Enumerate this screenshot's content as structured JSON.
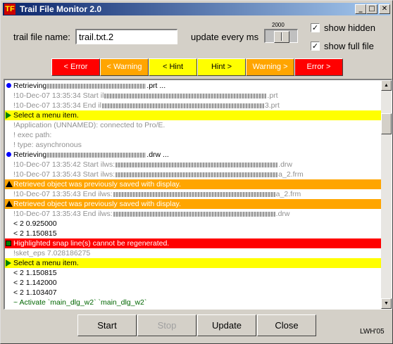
{
  "window": {
    "title": "Trail File Monitor 2.0",
    "controls": {
      "minimize": "_",
      "maximize": "□",
      "close": "✕"
    }
  },
  "settings": {
    "trail_label": "trail file name:",
    "trail_value": "trail.txt.2",
    "update_label": "update every ms",
    "update_value": "2000",
    "update_slider_fraction": 0.5,
    "show_hidden_label": "show hidden",
    "show_hidden_checked": true,
    "show_full_file_label": "show full file",
    "show_full_file_checked": true
  },
  "filters": [
    {
      "label": "< Error",
      "color": "#ff0000",
      "text_color": "#ffffff"
    },
    {
      "label": "< Warning",
      "color": "#ffa500",
      "text_color": "#ffffff"
    },
    {
      "label": "< Hint",
      "color": "#ffff00",
      "text_color": "#000000"
    },
    {
      "label": "Hint >",
      "color": "#ffff00",
      "text_color": "#000000"
    },
    {
      "label": "Warning >",
      "color": "#ffa500",
      "text_color": "#ffffff"
    },
    {
      "label": "Error >",
      "color": "#ff0000",
      "text_color": "#ffffff"
    }
  ],
  "log": [
    {
      "kind": "normal",
      "marker": "dot-icon",
      "text": "Retrieving",
      "redacted": "long",
      "text_after": ".prt ..."
    },
    {
      "kind": "grey",
      "marker": "",
      "text": "!10-Dec-07 13:35:34  Start  il",
      "redacted": "xl",
      "text_after": ".prt"
    },
    {
      "kind": "grey",
      "marker": "",
      "text": "!10-Dec-07 13:35:34  End    il",
      "redacted": "xl",
      "text_after": "3.prt"
    },
    {
      "kind": "hint",
      "marker": "arrow-right-icon",
      "text": "Select a menu item.",
      "redacted": "",
      "text_after": ""
    },
    {
      "kind": "grey",
      "marker": "",
      "text": "!Application (UNNAMED): connected to Pro/E.",
      "redacted": "",
      "text_after": ""
    },
    {
      "kind": "grey",
      "marker": "",
      "text": "!   exec path:",
      "redacted": "",
      "text_after": ""
    },
    {
      "kind": "grey",
      "marker": "",
      "text": "!   type: asynchronous",
      "redacted": "",
      "text_after": ""
    },
    {
      "kind": "normal",
      "marker": "dot-icon",
      "text": "Retrieving",
      "redacted": "long",
      "text_after": ".drw ..."
    },
    {
      "kind": "grey",
      "marker": "",
      "text": "!10-Dec-07 13:35:42  Start  ilws:",
      "redacted": "xl",
      "text_after": ".drw"
    },
    {
      "kind": "grey",
      "marker": "",
      "text": "!10-Dec-07 13:35:43  Start  ilws:",
      "redacted": "xl",
      "text_after": "a_2.frm"
    },
    {
      "kind": "warning",
      "marker": "warning-triangle-icon",
      "text": "Retrieved object was previously saved with display.",
      "redacted": "",
      "text_after": ""
    },
    {
      "kind": "grey",
      "marker": "",
      "text": "!10-Dec-07 13:35:43  End   ilws:",
      "redacted": "xl",
      "text_after": "a_2.frm"
    },
    {
      "kind": "warning",
      "marker": "warning-triangle-icon",
      "text": "Retrieved object was previously saved with display.",
      "redacted": "",
      "text_after": ""
    },
    {
      "kind": "grey",
      "marker": "",
      "text": "!10-Dec-07 13:35:43  End   ilws:",
      "redacted": "xl",
      "text_after": ".drw"
    },
    {
      "kind": "normal",
      "marker": "",
      "text": "< 2 0.925000",
      "redacted": "",
      "text_after": ""
    },
    {
      "kind": "normal",
      "marker": "",
      "text": "< 2 1.150815",
      "redacted": "",
      "text_after": ""
    },
    {
      "kind": "error",
      "marker": "error-icon",
      "text": "Highlighted snap line(s) cannot be regenerated.",
      "redacted": "",
      "text_after": ""
    },
    {
      "kind": "grey",
      "marker": "",
      "text": "!sket_eps        7.028186275",
      "redacted": "",
      "text_after": ""
    },
    {
      "kind": "hint",
      "marker": "arrow-right-icon",
      "text": "Select a menu item.",
      "redacted": "",
      "text_after": ""
    },
    {
      "kind": "normal",
      "marker": "",
      "text": "< 2 1.150815",
      "redacted": "",
      "text_after": ""
    },
    {
      "kind": "normal",
      "marker": "",
      "text": "< 2 1.142000",
      "redacted": "",
      "text_after": ""
    },
    {
      "kind": "normal",
      "marker": "",
      "text": "< 2 1.103407",
      "redacted": "",
      "text_after": ""
    },
    {
      "kind": "green",
      "marker": "",
      "text": "~ Activate `main_dlg_w2` `main_dlg_w2`",
      "redacted": "",
      "text_after": ""
    }
  ],
  "scrollbar": {
    "up": "▲",
    "down": "▼",
    "position_fraction": 0.12
  },
  "actions": {
    "start": "Start",
    "stop": "Stop",
    "update": "Update",
    "close": "Close"
  },
  "signature": "LWH'05"
}
